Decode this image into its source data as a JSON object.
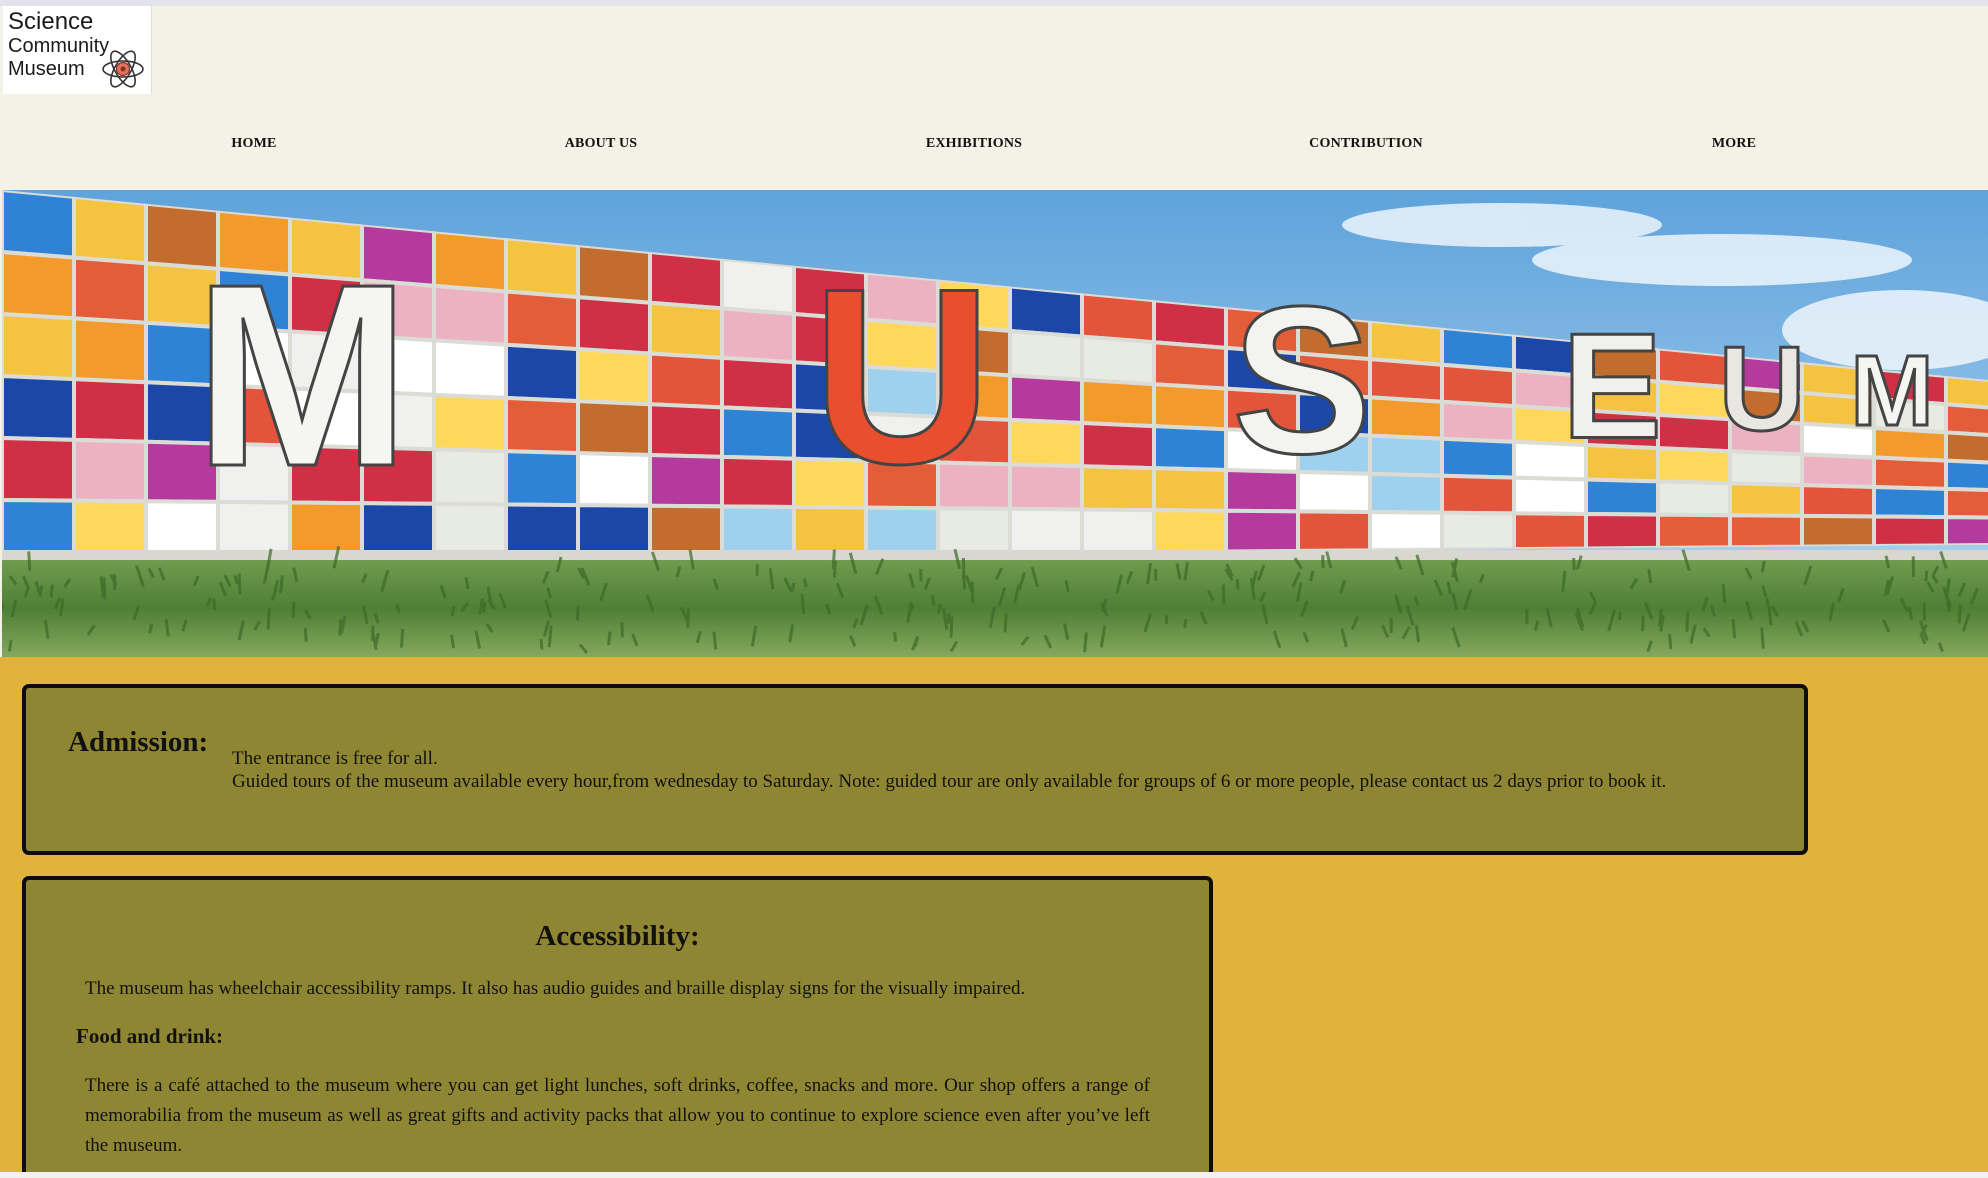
{
  "logo": {
    "line1": "Science",
    "line2": "Community",
    "line3": "Museum",
    "icon": "atom-icon"
  },
  "nav": {
    "items": [
      {
        "label": "HOME"
      },
      {
        "label": "ABOUT US"
      },
      {
        "label": "EXHIBITIONS"
      },
      {
        "label": "CONTRIBUTION"
      },
      {
        "label": "MORE"
      }
    ]
  },
  "hero": {
    "sign_text": "MUSEUM"
  },
  "admission": {
    "heading": "Admission:",
    "line1": "The entrance is free for all.",
    "line2": "Guided tours of the museum available every hour,from wednesday to Saturday. Note: guided tour are only available for groups of 6 or more people, please contact us 2 days prior to book it."
  },
  "accessibility": {
    "heading": "Accessibility:",
    "text": "The museum has wheelchair accessibility ramps. It also has audio guides and braille display signs for the visually impaired.",
    "food_heading": "Food and drink:",
    "food_text": "There is a café attached to the museum where you can get light lunches, soft drinks, coffee, snacks and more. Our shop offers a range of memorabilia from the museum as well as great gifts and activity packs that allow you to continue to explore science even after you’ve left the museum."
  },
  "colors": {
    "header_bg": "#f4f1e6",
    "main_bg": "#dfb33c",
    "box_bg": "#8e8633",
    "box_border": "#0d0d0d"
  }
}
